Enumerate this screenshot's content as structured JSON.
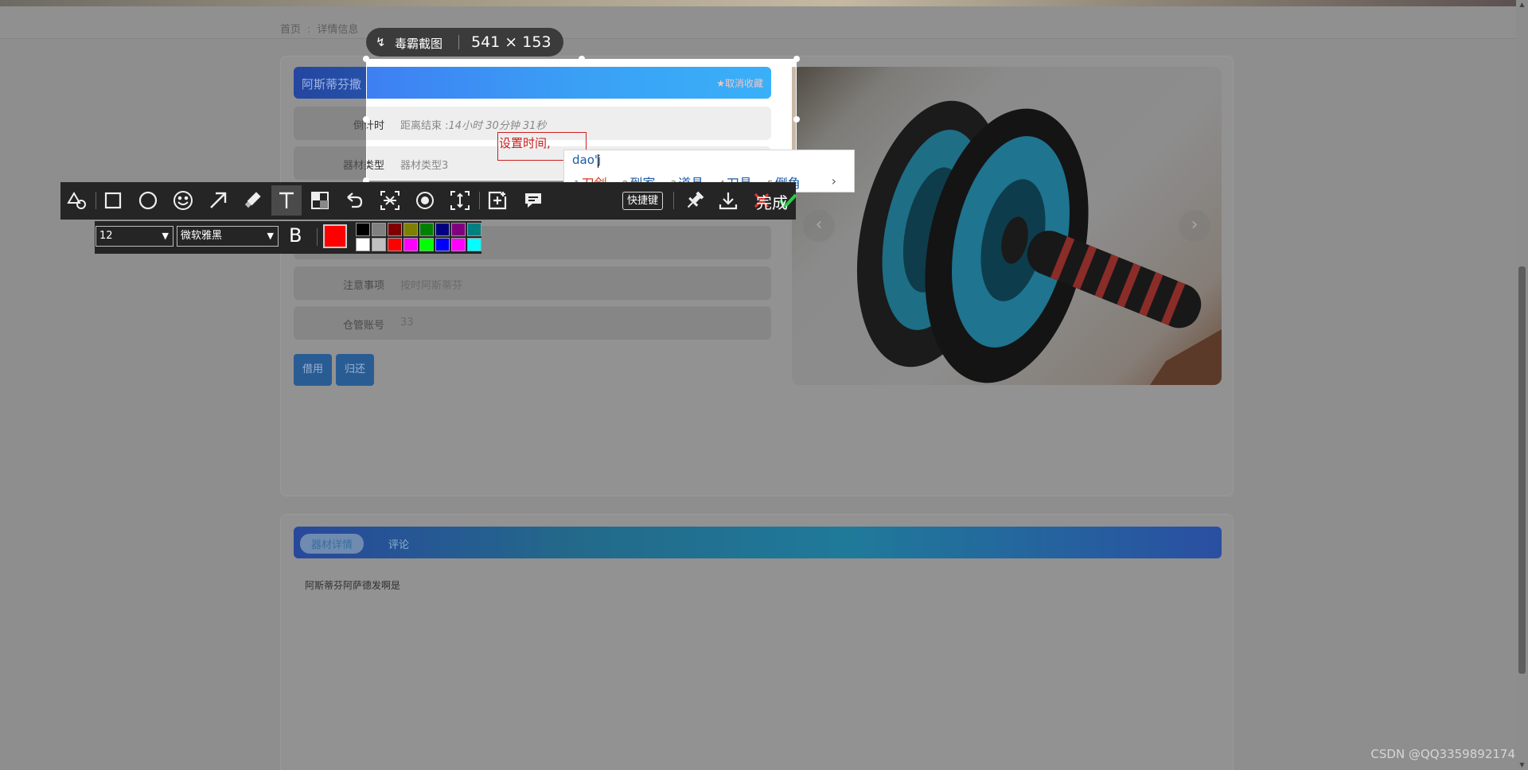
{
  "breadcrumb": {
    "home": "首页",
    "separator": ":",
    "current": "详情信息"
  },
  "equipment": {
    "title": "阿斯蒂芬撒",
    "unfavorite_label": "★取消收藏",
    "fields": [
      {
        "label": "倒计时",
        "value_prefix": "距离结束 :",
        "value_italic": "14小时 30分钟 31秒"
      },
      {
        "label": "器材类型",
        "value": "器材类型3"
      },
      {
        "label": "",
        "value": ""
      },
      {
        "label": "注意事项",
        "value": "按时阿斯蒂芬"
      },
      {
        "label": "仓管账号",
        "value": "33"
      }
    ],
    "borrow_label": "借用",
    "return_label": "归还"
  },
  "carousel": {
    "prev": "‹",
    "next": "›"
  },
  "tabs": {
    "items": [
      "器材详情",
      "评论"
    ],
    "active": "器材详情"
  },
  "detail_text": "阿斯蒂芬阿萨德发啊是",
  "screenshot_tool": {
    "app_name": "毒霸截图",
    "dimensions": "541 × 153",
    "annotation_text": "设置时间,",
    "shortcut_label": "快捷键",
    "done_label": "完成",
    "font_size": "12",
    "font_name": "微软雅黑",
    "bold_label": "B",
    "current_color": "#ff0000",
    "palette": [
      "#000000",
      "#808080",
      "#800000",
      "#808000",
      "#008000",
      "#000080",
      "#800080",
      "#008080",
      "#ffffff",
      "#c0c0c0",
      "#ff0000",
      "#ff00ff",
      "#00ff00",
      "#0000ff",
      "#ff00ff",
      "#00ffff"
    ],
    "tools": [
      "shape-tool-icon",
      "rectangle-icon",
      "ellipse-icon",
      "emoji-icon",
      "arrow-icon",
      "marker-icon",
      "text-icon",
      "mosaic-icon",
      "undo-icon",
      "ocr-icon",
      "record-icon",
      "long-screenshot-icon",
      "add-icon",
      "comment-icon"
    ],
    "active_tool": "text-icon"
  },
  "ime": {
    "composition": "dao'j",
    "candidates": [
      {
        "n": "1",
        "text": "刀剑"
      },
      {
        "n": "2",
        "text": "到家"
      },
      {
        "n": "3",
        "text": "道具"
      },
      {
        "n": "4",
        "text": "刀具"
      },
      {
        "n": "5",
        "text": "倒角"
      }
    ],
    "more": "›"
  },
  "watermark": "CSDN @QQ3359892174"
}
